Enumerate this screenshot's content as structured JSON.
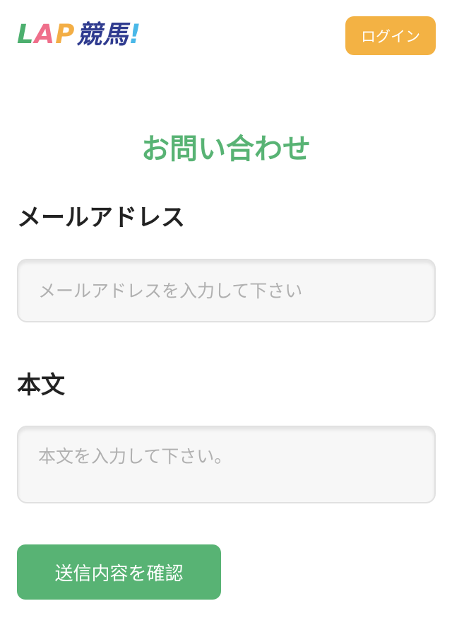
{
  "header": {
    "logo": {
      "l": "L",
      "a": "A",
      "p": "P",
      "keiba": "競馬",
      "bang": "!"
    },
    "login_label": "ログイン"
  },
  "main": {
    "title": "お問い合わせ",
    "email": {
      "label": "メールアドレス",
      "placeholder": "メールアドレスを入力して下さい",
      "value": ""
    },
    "body": {
      "label": "本文",
      "placeholder": "本文を入力して下さい。",
      "value": ""
    },
    "submit_label": "送信内容を確認"
  },
  "colors": {
    "accent_green": "#58b374",
    "login_orange": "#f3b244",
    "logo_l": "#4caf6e",
    "logo_a": "#ef6f8b",
    "logo_p": "#f3ae45",
    "logo_keiba": "#2f3b8f",
    "logo_bang": "#4ab8e8"
  }
}
